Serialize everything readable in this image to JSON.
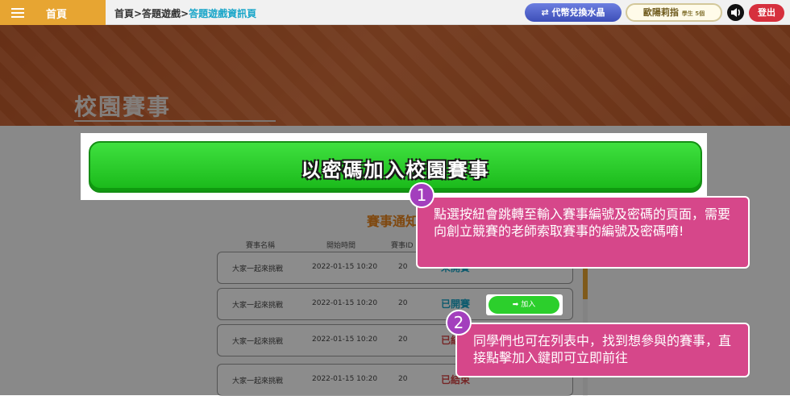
{
  "topbar": {
    "home_label": "首頁",
    "breadcrumb_path": "首頁>答題遊戲>",
    "breadcrumb_current": "答題遊戲資訊頁",
    "exchange_button": "代幣兌換水晶",
    "user_name": "歐陽莉指",
    "user_meta": "學生 5個",
    "logout_button": "登出"
  },
  "banner": {
    "title": "校園賽事"
  },
  "join": {
    "button_label": "以密碼加入校園賽事"
  },
  "list": {
    "section_title": "賽事通知",
    "columns": [
      "賽事名稱",
      "開始時間",
      "賽事ID"
    ],
    "rows": [
      {
        "name": "大家一起來挑戰",
        "start": "2022-01-15 10:20",
        "id": "20",
        "status": "未開賽",
        "action": ""
      },
      {
        "name": "大家一起來挑戰",
        "start": "2022-01-15 10:20",
        "id": "20",
        "status": "已開賽",
        "action": "加入"
      },
      {
        "name": "大家一起來挑戰",
        "start": "2022-01-15 10:20",
        "id": "20",
        "status": "已結束",
        "action": ""
      },
      {
        "name": "大家一起來挑戰",
        "start": "2022-01-15 10:20",
        "id": "20",
        "status": "已結束",
        "action": ""
      }
    ]
  },
  "callouts": [
    {
      "number": "1",
      "text": "點選按紐會跳轉至輸入賽事編號及密碼的頁面，需要向創立競賽的老師索取賽事的編號及密碼唷!"
    },
    {
      "number": "2",
      "text": "同學們也可在列表中，找到想參與的賽事，直接點擊加入鍵即可立即前往"
    }
  ],
  "colors": {
    "accent": "#e7a532",
    "join_green": "#2ccf2c",
    "callout": "#d6478a",
    "badge": "#a33fbd"
  }
}
